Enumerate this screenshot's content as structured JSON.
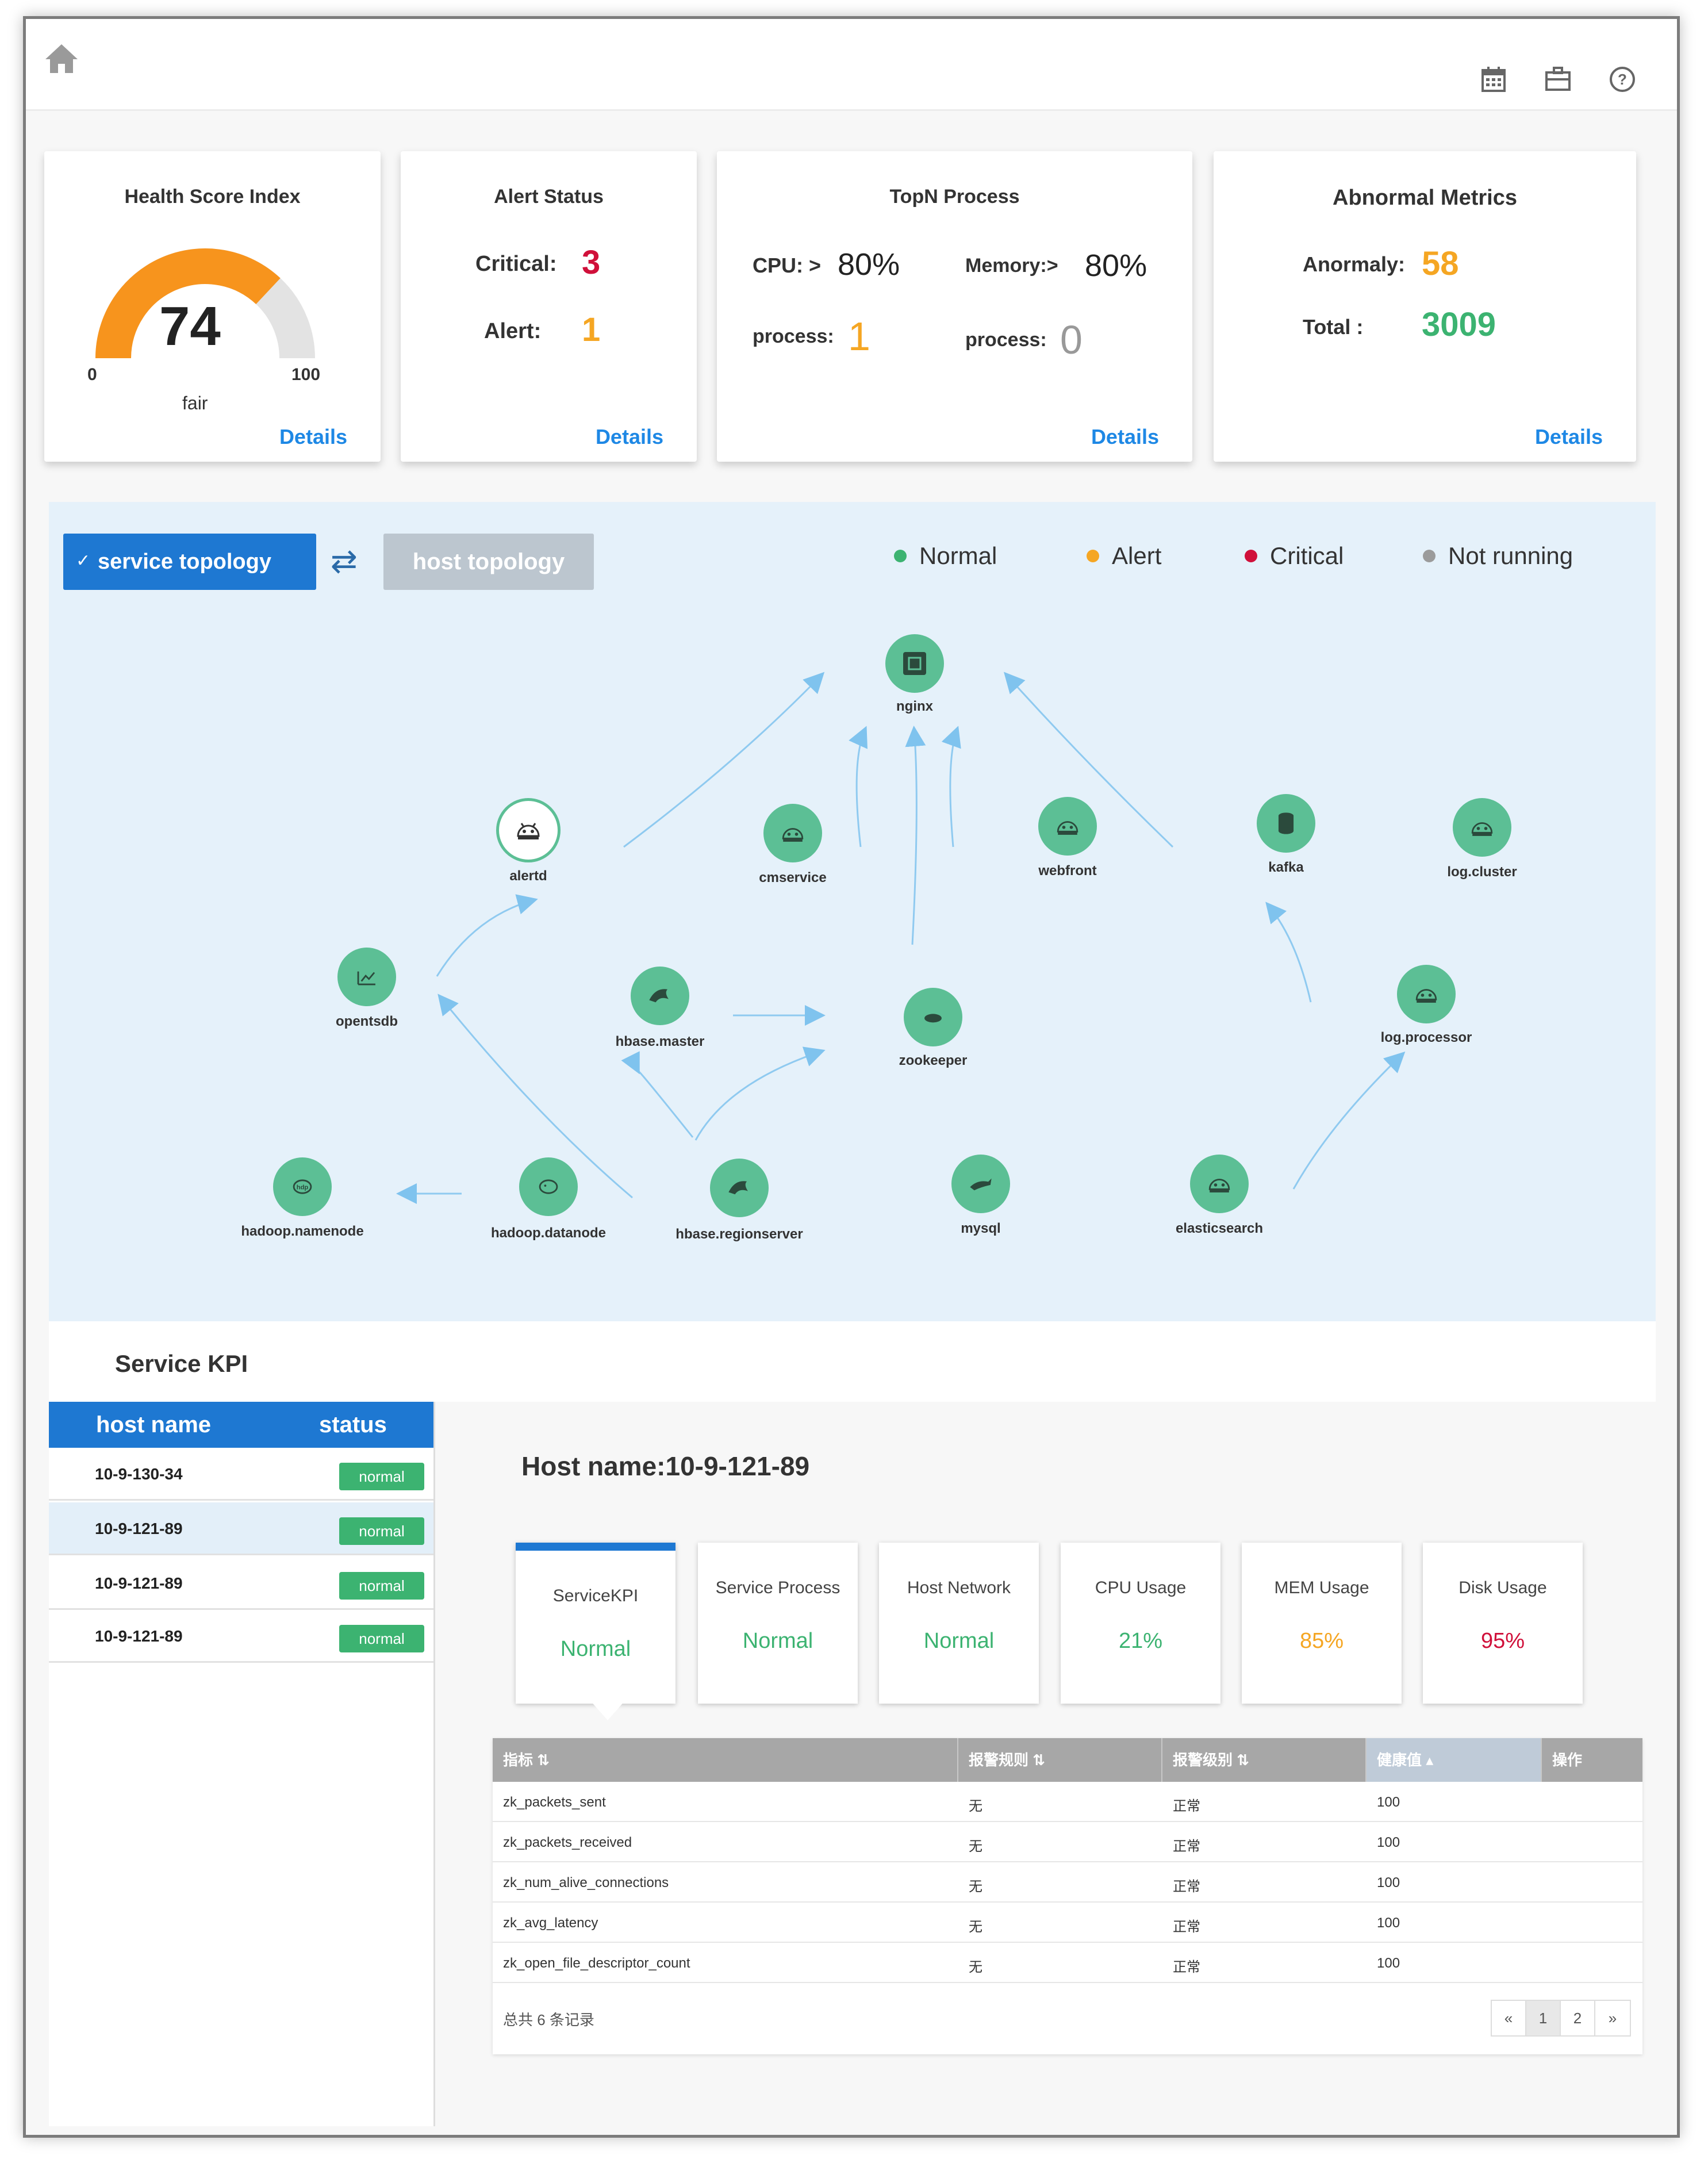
{
  "header": {
    "icons": [
      "home-icon",
      "calendar-icon",
      "briefcase-icon",
      "help-icon"
    ]
  },
  "cards": {
    "health": {
      "title": "Health Score Index",
      "value": "74",
      "min": "0",
      "max": "100",
      "status": "fair",
      "score_fraction": 0.74,
      "details": "Details"
    },
    "alert": {
      "title": "Alert Status",
      "critical_label": "Critical:",
      "critical_value": "3",
      "alert_label": "Alert:",
      "alert_value": "1",
      "details": "Details"
    },
    "topn": {
      "title": "TopN Process",
      "cpu_label": "CPU: >",
      "cpu_value": "80%",
      "mem_label": "Memory:>",
      "mem_value": "80%",
      "process_label_1": "process:",
      "process_value_1": "1",
      "process_label_2": "process:",
      "process_value_2": "0",
      "details": "Details"
    },
    "abnormal": {
      "title": "Abnormal Metrics",
      "anomaly_label": "Anormaly:",
      "anomaly_value": "58",
      "total_label": "Total :",
      "total_value": "3009",
      "details": "Details"
    }
  },
  "topology": {
    "service_button": "service topology",
    "host_button": "host topology",
    "legend": [
      {
        "label": "Normal",
        "color": "#3cb371"
      },
      {
        "label": "Alert",
        "color": "#f5a623"
      },
      {
        "label": "Critical",
        "color": "#d0103a"
      },
      {
        "label": "Not running",
        "color": "#9b9b9b"
      }
    ],
    "nodes": {
      "nginx": "nginx",
      "alertd": "alertd",
      "cmservice": "cmservice",
      "webfront": "webfront",
      "kafka": "kafka",
      "log_cluster": "log.cluster",
      "opentsdb": "opentsdb",
      "hbase_master": "hbase.master",
      "zookeeper": "zookeeper",
      "log_processor": "log.processor",
      "hadoop_namenode": "hadoop.namenode",
      "hadoop_datanode": "hadoop.datanode",
      "hbase_regionserver": "hbase.regionserver",
      "mysql": "mysql",
      "elasticsearch": "elasticsearch"
    }
  },
  "service_kpi": {
    "title": "Service KPI",
    "host_table": {
      "headers": [
        "host name",
        "status"
      ],
      "rows": [
        {
          "host": "10-9-130-34",
          "status": "normal"
        },
        {
          "host": "10-9-121-89",
          "status": "normal"
        },
        {
          "host": "10-9-121-89",
          "status": "normal"
        },
        {
          "host": "10-9-121-89",
          "status": "normal"
        }
      ]
    },
    "detail": {
      "title": "Host name:10-9-121-89",
      "cards": [
        {
          "title": "ServiceKPI",
          "value": "Normal",
          "color": "#3cb371"
        },
        {
          "title": "Service Process",
          "value": "Normal",
          "color": "#3cb371"
        },
        {
          "title": "Host Network",
          "value": "Normal",
          "color": "#3cb371"
        },
        {
          "title": "CPU Usage",
          "value": "21%",
          "color": "#3cb371"
        },
        {
          "title": "MEM Usage",
          "value": "85%",
          "color": "#f5a623"
        },
        {
          "title": "Disk Usage",
          "value": "95%",
          "color": "#d0103a"
        }
      ],
      "table": {
        "headers": [
          "指标 ⇅",
          "报警规则 ⇅",
          "报警级别 ⇅",
          "健康值 ▴",
          "操作"
        ],
        "rows": [
          [
            "zk_packets_sent",
            "无",
            "正常",
            "100"
          ],
          [
            "zk_packets_received",
            "无",
            "正常",
            "100"
          ],
          [
            "zk_num_alive_connections",
            "无",
            "正常",
            "100"
          ],
          [
            "zk_avg_latency",
            "无",
            "正常",
            "100"
          ],
          [
            "zk_open_file_descriptor_count",
            "无",
            "正常",
            "100"
          ]
        ],
        "footer": "总共 6 条记录",
        "pager": [
          "«",
          "1",
          "2",
          "»"
        ]
      }
    }
  }
}
